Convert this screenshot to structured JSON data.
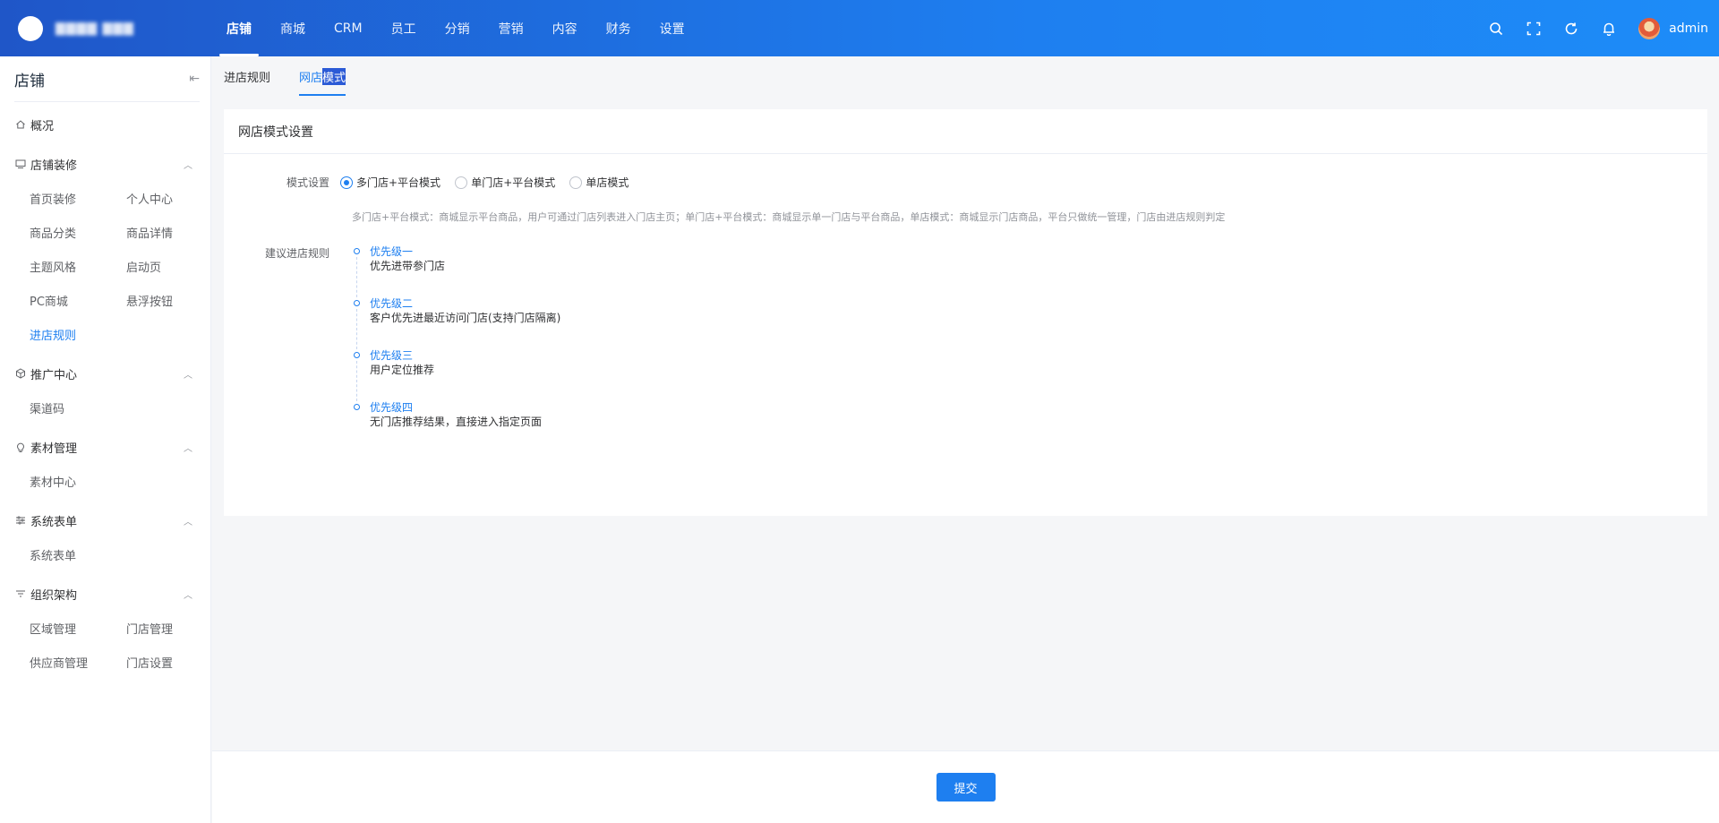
{
  "header": {
    "app_name": "▇▇▇▇ ▇▇▇",
    "nav": [
      "店铺",
      "商城",
      "CRM",
      "员工",
      "分销",
      "营销",
      "内容",
      "财务",
      "设置"
    ],
    "user": "admin"
  },
  "sidebar": {
    "title": "店铺",
    "overview": "概况",
    "groups": [
      {
        "title": "店铺装修",
        "icon": "monitor-icon",
        "items": [
          "首页装修",
          "个人中心",
          "商品分类",
          "商品详情",
          "主题风格",
          "启动页",
          "PC商城",
          "悬浮按钮",
          "进店规则"
        ]
      },
      {
        "title": "推广中心",
        "icon": "cube-icon",
        "items": [
          "渠道码"
        ]
      },
      {
        "title": "素材管理",
        "icon": "bulb-icon",
        "items": [
          "素材中心"
        ]
      },
      {
        "title": "系统表单",
        "icon": "sliders-icon",
        "items": [
          "系统表单"
        ]
      },
      {
        "title": "组织架构",
        "icon": "filter-icon",
        "items": [
          "区域管理",
          "门店管理",
          "供应商管理",
          "门店设置"
        ]
      }
    ],
    "active_item": "进店规则"
  },
  "tabs": {
    "tab1": "进店规则",
    "tab2_a": "网店",
    "tab2_b": "模式"
  },
  "card": {
    "title": "网店模式设置",
    "mode_label": "模式设置",
    "modes": [
      "多门店+平台模式",
      "单门店+平台模式",
      "单店模式"
    ],
    "selected_mode": "多门店+平台模式",
    "description": "多门店+平台模式：商城显示平台商品，用户可通过门店列表进入门店主页；单门店+平台模式：商城显示单一门店与平台商品，单店模式：商城显示门店商品，平台只做统一管理，门店由进店规则判定",
    "rules_label": "建议进店规则",
    "rules": [
      {
        "title": "优先级一",
        "text": "优先进带参门店"
      },
      {
        "title": "优先级二",
        "text": "客户优先进最近访问门店(支持门店隔离)"
      },
      {
        "title": "优先级三",
        "text": "用户定位推荐"
      },
      {
        "title": "优先级四",
        "text": "无门店推荐结果，直接进入指定页面"
      }
    ]
  },
  "footer": {
    "submit_label": "提交"
  },
  "colors": {
    "primary": "#1e7ff0",
    "header_start": "#1f56c8",
    "header_end": "#1d8cf8"
  }
}
